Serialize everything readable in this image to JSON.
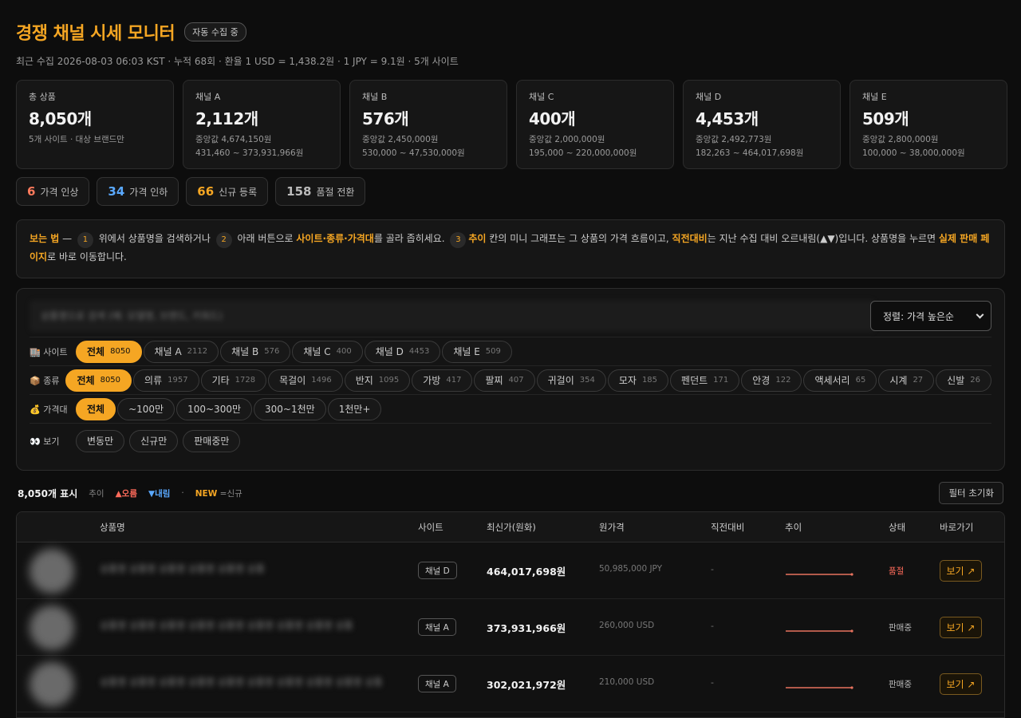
{
  "header": {
    "title": "경쟁 채널 시세 모니터",
    "status_badge": "자동 수집 중",
    "subtitle": "최근 수집 2026-08-03 06:03 KST · 누적 68회 · 환율 1 USD = 1,438.2원 · 1 JPY = 9.1원 · 5개 사이트"
  },
  "stats": [
    {
      "label": "총 상품",
      "value": "8,050개",
      "sub1": "5개 사이트 · 대상 브랜드만",
      "sub2": ""
    },
    {
      "label": "채널 A",
      "value": "2,112개",
      "sub1": "중앙값 4,674,150원",
      "sub2": "431,460 ~ 373,931,966원"
    },
    {
      "label": "채널 B",
      "value": "576개",
      "sub1": "중앙값 2,450,000원",
      "sub2": "530,000 ~ 47,530,000원"
    },
    {
      "label": "채널 C",
      "value": "400개",
      "sub1": "중앙값 2,000,000원",
      "sub2": "195,000 ~ 220,000,000원"
    },
    {
      "label": "채널 D",
      "value": "4,453개",
      "sub1": "중앙값 2,492,773원",
      "sub2": "182,263 ~ 464,017,698원"
    },
    {
      "label": "채널 E",
      "value": "509개",
      "sub1": "중앙값 2,800,000원",
      "sub2": "100,000 ~ 38,000,000원"
    }
  ],
  "changes": [
    {
      "num": "6",
      "label": "가격 인상",
      "color": "#ff7a5c"
    },
    {
      "num": "34",
      "label": "가격 인하",
      "color": "#5aa9ff"
    },
    {
      "num": "66",
      "label": "신규 등록",
      "color": "#f5a623"
    },
    {
      "num": "158",
      "label": "품절 전환",
      "color": "#bbbbbb"
    }
  ],
  "guide": {
    "t1": "보는 법",
    "t2": " — ",
    "s1": "1",
    "t3": " 위에서 상품명을 검색하거나 ",
    "s2": "2",
    "t4": " 아래 버튼으로 ",
    "t5": "사이트·종류·가격대",
    "t6": "를 골라 좁히세요. ",
    "s3": "3",
    "t7": "추이",
    "t8": " 칸의 미니 그래프는 그 상품의 가격 흐름이고, ",
    "t9": "직전대비",
    "t10": "는 지난 수집 대비 오르내림(▲▼)입니다. 상품명을 누르면 ",
    "t11": "실제 판매 페이지",
    "t12": "로 바로 이동합니다."
  },
  "search": {
    "placeholder": "상품명으로 검색 (예: 모델명, 브랜드, 키워드)"
  },
  "sort": {
    "label": "정렬: 가격 높은순"
  },
  "filters": {
    "site": {
      "icon": "🏬",
      "label": "사이트",
      "chips": [
        {
          "name": "전체",
          "count": "8050",
          "active": true
        },
        {
          "name": "채널 A",
          "count": "2112"
        },
        {
          "name": "채널 B",
          "count": "576"
        },
        {
          "name": "채널 C",
          "count": "400"
        },
        {
          "name": "채널 D",
          "count": "4453"
        },
        {
          "name": "채널 E",
          "count": "509"
        }
      ]
    },
    "kind": {
      "icon": "📦",
      "label": "종류",
      "chips": [
        {
          "name": "전체",
          "count": "8050",
          "active": true
        },
        {
          "name": "의류",
          "count": "1957"
        },
        {
          "name": "기타",
          "count": "1728"
        },
        {
          "name": "목걸이",
          "count": "1496"
        },
        {
          "name": "반지",
          "count": "1095"
        },
        {
          "name": "가방",
          "count": "417"
        },
        {
          "name": "팔찌",
          "count": "407"
        },
        {
          "name": "귀걸이",
          "count": "354"
        },
        {
          "name": "모자",
          "count": "185"
        },
        {
          "name": "펜던트",
          "count": "171"
        },
        {
          "name": "안경",
          "count": "122"
        },
        {
          "name": "액세서리",
          "count": "65"
        },
        {
          "name": "시계",
          "count": "27"
        },
        {
          "name": "신발",
          "count": "26"
        }
      ]
    },
    "price": {
      "icon": "💰",
      "label": "가격대",
      "chips": [
        {
          "name": "전체",
          "count": "",
          "active": true
        },
        {
          "name": "~100만",
          "count": ""
        },
        {
          "name": "100~300만",
          "count": ""
        },
        {
          "name": "300~1천만",
          "count": ""
        },
        {
          "name": "1천만+",
          "count": ""
        }
      ]
    },
    "view": {
      "icon": "👀",
      "label": "보기",
      "chips": [
        {
          "name": "변동만",
          "count": ""
        },
        {
          "name": "신규만",
          "count": ""
        },
        {
          "name": "판매중만",
          "count": ""
        }
      ]
    }
  },
  "results": {
    "count": "8,050개 표시",
    "legend_trend": "추이",
    "legend_up": "▲오름",
    "legend_down": "▼내림",
    "legend_dot": "·",
    "legend_new": "NEW",
    "legend_new_desc": "=신규",
    "reset": "필터 초기화"
  },
  "table": {
    "headers": [
      "상품명",
      "사이트",
      "최신가(원화)",
      "원가격",
      "직전대비",
      "추이",
      "상태",
      "바로가기"
    ],
    "rows": [
      {
        "name": "상품명 상품명 상품명 상품명 상품명 상품",
        "site": "채널 D",
        "price": "464,017,698원",
        "orig": "50,985,000 JPY",
        "delta": "-",
        "status": "품절",
        "soldout": true,
        "go": "보기 ↗"
      },
      {
        "name": "상품명 상품명 상품명 상품명 상품명 상품명 상품명 상품명 상품",
        "site": "채널 A",
        "price": "373,931,966원",
        "orig": "260,000 USD",
        "delta": "-",
        "status": "판매중",
        "soldout": false,
        "go": "보기 ↗"
      },
      {
        "name": "상품명 상품명 상품명 상품명 상품명 상품명 상품명 상품명 상품명 상품",
        "site": "채널 A",
        "price": "302,021,972원",
        "orig": "210,000 USD",
        "delta": "-",
        "status": "판매중",
        "soldout": false,
        "go": "보기 ↗"
      }
    ]
  },
  "colors": {
    "accent": "#f5a623",
    "up": "#ff6b5b",
    "down": "#5aa9ff",
    "spark": "#e8735f"
  }
}
